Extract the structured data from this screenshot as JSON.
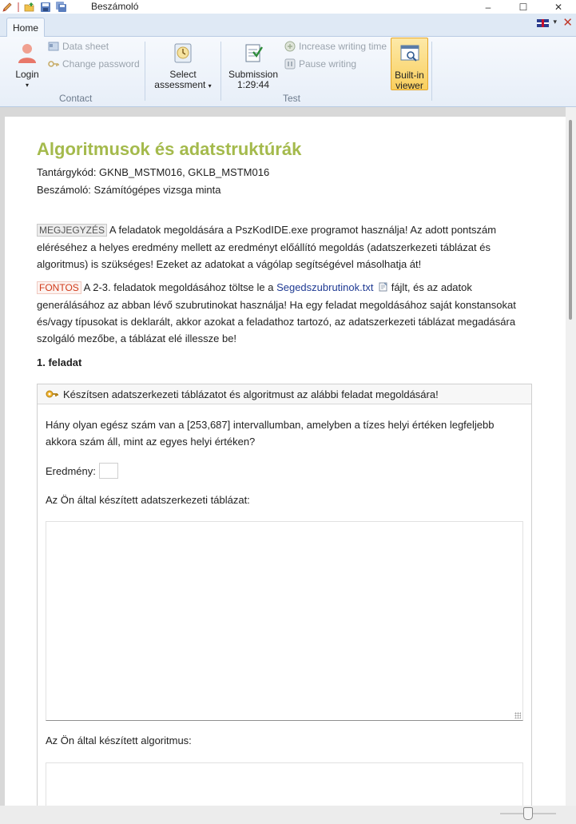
{
  "window": {
    "title": "Beszámoló",
    "minimize_glyph": "–",
    "maximize_glyph": "☐",
    "close_glyph": "✕"
  },
  "quick_access": [
    "pencil-icon",
    "open-folder-icon",
    "save-icon",
    "save-all-icon"
  ],
  "tabs": [
    {
      "label": "Home"
    }
  ],
  "language": {
    "flag": "uk-flag-icon",
    "caret": "▾",
    "close": "✕"
  },
  "ribbon": {
    "contact": {
      "group_label": "Contact",
      "login_label": "Login",
      "login_caret": "▾",
      "data_sheet_label": "Data sheet",
      "change_password_label": "Change password"
    },
    "assessment": {
      "select_label_1": "Select",
      "select_label_2": "assessment",
      "select_caret": "▾"
    },
    "test": {
      "group_label": "Test",
      "submission_label": "Submission",
      "submission_time": "1:29:44",
      "increase_time_label": "Increase writing time",
      "pause_label": "Pause writing",
      "viewer_label_1": "Built-in",
      "viewer_label_2": "viewer"
    }
  },
  "document": {
    "title": "Algoritmusok és adatstruktúrák",
    "course_code": "Tantárgykód: GKNB_MSTM016, GKLB_MSTM016",
    "exam": "Beszámoló: Számítógépes vizsga minta",
    "note_tag": "MEGJEGYZÉS",
    "note_text": " A feladatok megoldására a PszKodIDE.exe programot használja! Az adott pontszám eléréséhez a helyes eredmény mellett az eredményt előállító megoldás (adatszerkezeti táblázat és algoritmus) is szükséges! Ezeket az adatokat a vágólap segítségével másolhatja át!",
    "important_tag": "FONTOS",
    "important_text_1": " A 2-3. feladatok megoldásához töltse le a ",
    "important_link": "Segedszubrutinok.txt",
    "important_text_2": " fájlt, és az adatok generálásához az abban lévő szubrutinokat használja! Ha egy feladat megoldásához saját konstansokat és/vagy típusokat is deklarált, akkor azokat a feladathoz tartozó, az adatszerkezeti táblázat megadására szolgáló mezőbe, a táblázat elé illessze be!",
    "task1_heading": "1. feladat",
    "task1": {
      "instruction": "Készítsen adatszerkezeti táblázatot és algoritmust az alábbi feladat megoldására!",
      "question": "Hány olyan egész szám van a [253,687] intervallumban, amelyben a tízes helyi értéken legfeljebb akkora szám áll, mint az egyes helyi értéken?",
      "result_label": "Eredmény:",
      "result_value": "",
      "table_label": "Az Ön által készített adatszerkezeti táblázat:",
      "table_value": "",
      "algorithm_label": "Az Ön által készített algoritmus:",
      "algorithm_value": ""
    }
  },
  "colors": {
    "title_green": "#a4ba4c",
    "important_red": "#d03a1a",
    "link_blue": "#1f3a93",
    "active_yellow": "#f9cf5e"
  }
}
